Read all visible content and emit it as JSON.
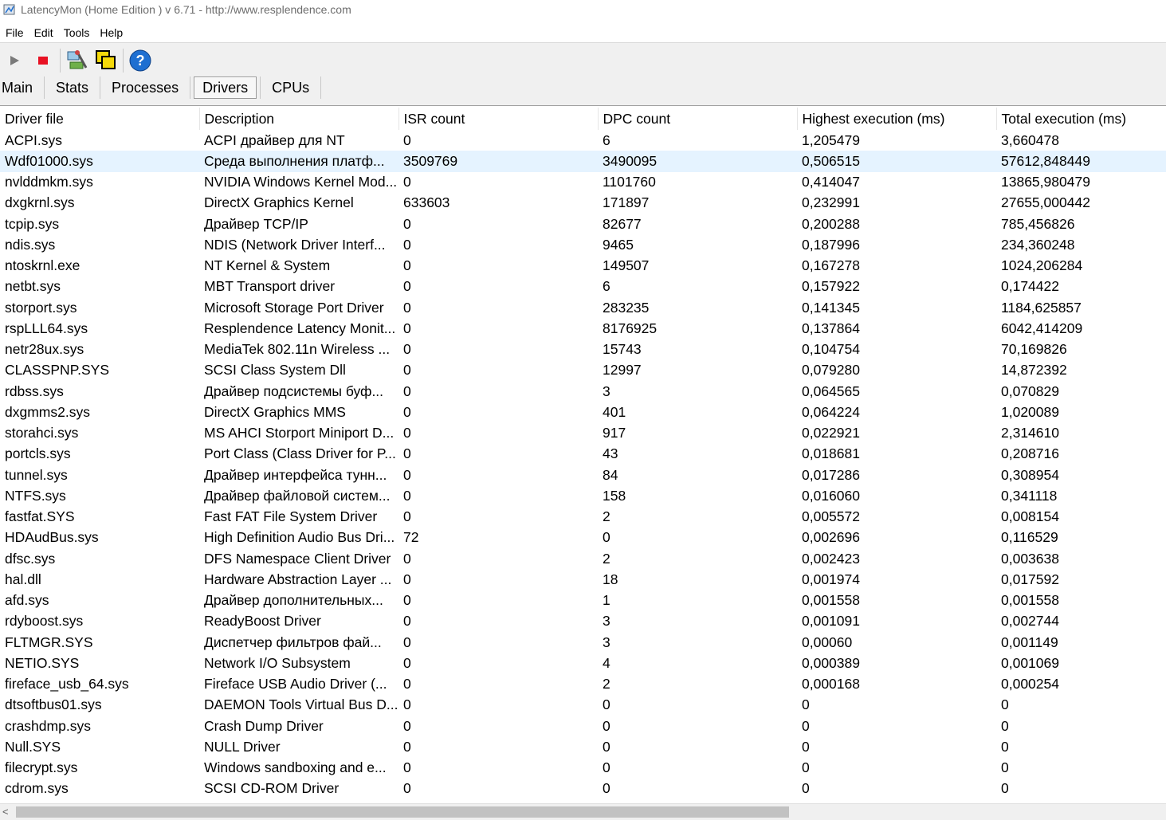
{
  "window": {
    "title": "LatencyMon  (Home Edition )  v 6.71 - http://www.resplendence.com"
  },
  "menu": [
    "File",
    "Edit",
    "Tools",
    "Help"
  ],
  "toolbar": {
    "icons": [
      "play-icon",
      "stop-icon",
      "analyze-icon",
      "windows-icon",
      "help-icon"
    ],
    "colors": {
      "stop": "#e81123",
      "play": "#7a7a7a",
      "help": "#1e6fd1"
    }
  },
  "tabs": [
    "Main",
    "Stats",
    "Processes",
    "Drivers",
    "CPUs"
  ],
  "active_tab": "Drivers",
  "table": {
    "columns": [
      "Driver file",
      "Description",
      "ISR count",
      "DPC count",
      "Highest execution (ms)",
      "Total execution (ms)"
    ],
    "selected_row": 1,
    "rows": [
      [
        "ACPI.sys",
        "ACPI драйвер для NT",
        "0",
        "6",
        "1,205479",
        "3,660478"
      ],
      [
        "Wdf01000.sys",
        "Среда выполнения платф...",
        "3509769",
        "3490095",
        "0,506515",
        "57612,848449"
      ],
      [
        "nvlddmkm.sys",
        "NVIDIA Windows Kernel Mod...",
        "0",
        "1101760",
        "0,414047",
        "13865,980479"
      ],
      [
        "dxgkrnl.sys",
        "DirectX Graphics Kernel",
        "633603",
        "171897",
        "0,232991",
        "27655,000442"
      ],
      [
        "tcpip.sys",
        "Драйвер TCP/IP",
        "0",
        "82677",
        "0,200288",
        "785,456826"
      ],
      [
        "ndis.sys",
        "NDIS (Network Driver Interf...",
        "0",
        "9465",
        "0,187996",
        "234,360248"
      ],
      [
        "ntoskrnl.exe",
        "NT Kernel & System",
        "0",
        "149507",
        "0,167278",
        "1024,206284"
      ],
      [
        "netbt.sys",
        "MBT Transport driver",
        "0",
        "6",
        "0,157922",
        "0,174422"
      ],
      [
        "storport.sys",
        "Microsoft Storage Port Driver",
        "0",
        "283235",
        "0,141345",
        "1184,625857"
      ],
      [
        "rspLLL64.sys",
        "Resplendence Latency Monit...",
        "0",
        "8176925",
        "0,137864",
        "6042,414209"
      ],
      [
        "netr28ux.sys",
        "MediaTek 802.11n Wireless ...",
        "0",
        "15743",
        "0,104754",
        "70,169826"
      ],
      [
        "CLASSPNP.SYS",
        "SCSI Class System Dll",
        "0",
        "12997",
        "0,079280",
        "14,872392"
      ],
      [
        "rdbss.sys",
        "Драйвер подсистемы буф...",
        "0",
        "3",
        "0,064565",
        "0,070829"
      ],
      [
        "dxgmms2.sys",
        "DirectX Graphics MMS",
        "0",
        "401",
        "0,064224",
        "1,020089"
      ],
      [
        "storahci.sys",
        "MS AHCI Storport Miniport D...",
        "0",
        "917",
        "0,022921",
        "2,314610"
      ],
      [
        "portcls.sys",
        "Port Class (Class Driver for P...",
        "0",
        "43",
        "0,018681",
        "0,208716"
      ],
      [
        "tunnel.sys",
        "Драйвер интерфейса тунн...",
        "0",
        "84",
        "0,017286",
        "0,308954"
      ],
      [
        "NTFS.sys",
        "Драйвер файловой систем...",
        "0",
        "158",
        "0,016060",
        "0,341118"
      ],
      [
        "fastfat.SYS",
        "Fast FAT File System Driver",
        "0",
        "2",
        "0,005572",
        "0,008154"
      ],
      [
        "HDAudBus.sys",
        "High Definition Audio Bus Dri...",
        "72",
        "0",
        "0,002696",
        "0,116529"
      ],
      [
        "dfsc.sys",
        "DFS Namespace Client Driver",
        "0",
        "2",
        "0,002423",
        "0,003638"
      ],
      [
        "hal.dll",
        "Hardware Abstraction Layer ...",
        "0",
        "18",
        "0,001974",
        "0,017592"
      ],
      [
        "afd.sys",
        "Драйвер дополнительных...",
        "0",
        "1",
        "0,001558",
        "0,001558"
      ],
      [
        "rdyboost.sys",
        "ReadyBoost Driver",
        "0",
        "3",
        "0,001091",
        "0,002744"
      ],
      [
        "FLTMGR.SYS",
        "Диспетчер фильтров фай...",
        "0",
        "3",
        "0,00060",
        "0,001149"
      ],
      [
        "NETIO.SYS",
        "Network I/O Subsystem",
        "0",
        "4",
        "0,000389",
        "0,001069"
      ],
      [
        "fireface_usb_64.sys",
        "Fireface USB Audio Driver (...",
        "0",
        "2",
        "0,000168",
        "0,000254"
      ],
      [
        "dtsoftbus01.sys",
        "DAEMON Tools Virtual Bus D...",
        "0",
        "0",
        "0",
        "0"
      ],
      [
        "crashdmp.sys",
        "Crash Dump Driver",
        "0",
        "0",
        "0",
        "0"
      ],
      [
        "Null.SYS",
        "NULL Driver",
        "0",
        "0",
        "0",
        "0"
      ],
      [
        "filecrypt.sys",
        "Windows sandboxing and e...",
        "0",
        "0",
        "0",
        "0"
      ],
      [
        "cdrom.sys",
        "SCSI CD-ROM Driver",
        "0",
        "0",
        "0",
        "0"
      ]
    ]
  },
  "scrollbar": {
    "left_arrow": "<"
  }
}
